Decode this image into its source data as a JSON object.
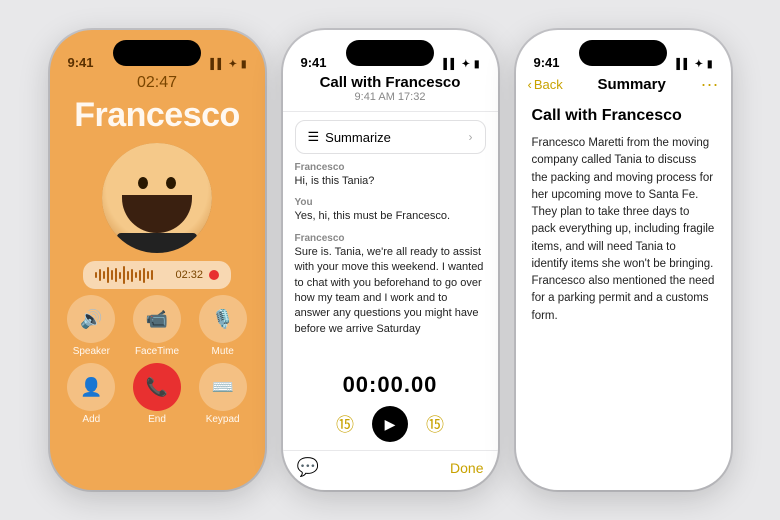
{
  "phone1": {
    "statusTime": "9:41",
    "statusIcons": "▌▌ ✦ ⬛",
    "callDuration": "02:47",
    "callerName": "Francesco",
    "waveTime": "02:32",
    "buttons": [
      {
        "icon": "🔊",
        "label": "Speaker"
      },
      {
        "icon": "📹",
        "label": "FaceTime"
      },
      {
        "icon": "🎤",
        "label": "Mute"
      },
      {
        "icon": "👤",
        "label": "Add"
      },
      {
        "icon": "📞",
        "label": "End",
        "type": "end"
      },
      {
        "icon": "⌨️",
        "label": "Keypad"
      }
    ]
  },
  "phone2": {
    "statusTime": "9:41",
    "title": "Call with Francesco",
    "subtitle": "9:41 AM  17:32",
    "summarizeLabel": "Summarize",
    "messages": [
      {
        "speaker": "Francesco",
        "text": "Hi, is this Tania?"
      },
      {
        "speaker": "You",
        "text": "Yes, hi, this must be Francesco."
      },
      {
        "speaker": "Francesco",
        "text": "Sure is. Tania, we're all ready to assist with your move this weekend. I wanted to chat with you beforehand to go over how my team and I work and to answer any questions you might have before we arrive Saturday"
      }
    ],
    "timer": "00:00.00",
    "skipBack": "⑮",
    "skipForward": "⑮",
    "doneLabel": "Done"
  },
  "phone3": {
    "statusTime": "9:41",
    "backLabel": "Back",
    "navTitle": "Summary",
    "callTitle": "Call with Francesco",
    "summaryText": "Francesco Maretti from the moving company called Tania to discuss the packing and moving process for her upcoming move to Santa Fe. They plan to take three days to pack everything up, including fragile items, and will need Tania to identify items she won't be bringing. Francesco also mentioned the need for a parking permit and a customs form."
  }
}
